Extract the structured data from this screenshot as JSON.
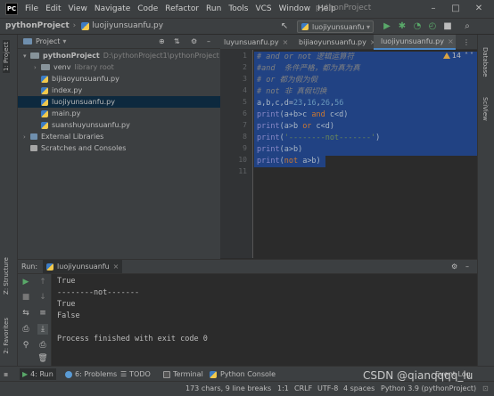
{
  "menubar": {
    "logo_text": "PC",
    "items": [
      "File",
      "Edit",
      "View",
      "Navigate",
      "Code",
      "Refactor",
      "Run",
      "Tools",
      "VCS",
      "Window",
      "Help"
    ],
    "window_title": "pythonProject",
    "controls": [
      "–",
      "□",
      "✕"
    ]
  },
  "navbar": {
    "project": "pythonProject",
    "file": "luojiyunsuanfu.py",
    "run_config": "luojiyunsuanfu"
  },
  "left_strip": {
    "project_tab": "1: Project",
    "structure_tab": "Z: Structure",
    "favorites_tab": "2: Favorites"
  },
  "right_strip": {
    "database_tab": "Database",
    "sciview_tab": "SciView"
  },
  "project_panel": {
    "title": "Project",
    "root_name": "pythonProject",
    "root_path": "D:\\pythonProject1\\pythonProject",
    "venv": "venv",
    "venv_note": "library root",
    "files": [
      "bijiaoyunsuanfu.py",
      "index.py",
      "luojiyunsuanfu.py",
      "main.py",
      "suanshuyunsuanfu.py"
    ],
    "external": "External Libraries",
    "scratches": "Scratches and Consoles"
  },
  "editor": {
    "tabs": [
      "luyunsuanfu.py",
      "bijiaoyunsuanfu.py",
      "luojiyunsuanfu.py"
    ],
    "inspect_count": "14",
    "line_numbers": [
      "1",
      "2",
      "3",
      "4",
      "5",
      "6",
      "7",
      "8",
      "9",
      "10",
      "11"
    ],
    "lines": {
      "l1": "# and or not 逻辑运算符",
      "l2": "#and  条件严格，都为真为真",
      "l3": "# or 都为假为假",
      "l4": "# not 非 真假切换",
      "l5a": "a",
      "l5b": ",b,c,d=",
      "l5c": "23",
      "l5d": ",",
      "l5e": "16",
      "l5f": ",",
      "l5g": "26",
      "l5h": ",",
      "l5i": "56",
      "l6a": "print",
      "l6b": "(a+b>c ",
      "l6c": "and",
      "l6d": " c<d)",
      "l7a": "print",
      "l7b": "(a>b ",
      "l7c": "or",
      "l7d": " c<d)",
      "l8a": "print",
      "l8b": "(",
      "l8c": "'--------not-------'",
      "l8d": ")",
      "l9a": "print",
      "l9b": "(a>b)",
      "l10a": "print",
      "l10b": "(",
      "l10c": "not",
      "l10d": " a>b)"
    }
  },
  "run_panel": {
    "label": "Run:",
    "tab": "luojiyunsuanfu",
    "output": [
      "True",
      "--------not-------",
      "True",
      "False",
      "",
      "Process finished with exit code 0"
    ]
  },
  "bottom_tabs": [
    "4: Run",
    "6: Problems",
    "TODO",
    "Terminal",
    "Python Console",
    "Event Log"
  ],
  "status": {
    "chars": "173 chars, 9 line breaks",
    "position": "1:1",
    "line_sep": "CRLF",
    "encoding": "UTF-8",
    "indent": "4 spaces",
    "interpreter": "Python 3.9 (pythonProject)"
  },
  "watermark": "CSDN @qianqqqq_lu",
  "colors": {
    "accent": "#4a88c7",
    "selection": "#214283",
    "run_green": "#59a869",
    "keyword": "#cc7832",
    "number": "#6897bb",
    "string": "#6a8759"
  }
}
